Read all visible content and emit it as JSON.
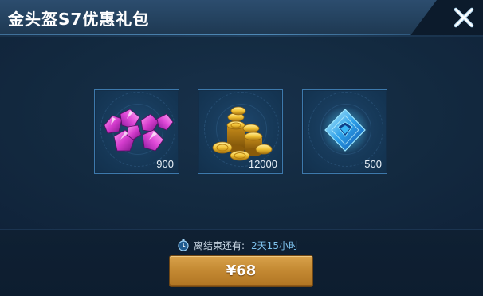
{
  "dialog": {
    "title": "金头盔S7优惠礼包",
    "close_icon": "close-icon"
  },
  "items": [
    {
      "name": "purple-gems",
      "icon": "purple-gem-icon",
      "quantity": "900"
    },
    {
      "name": "gold-coins",
      "icon": "gold-coin-icon",
      "quantity": "12000"
    },
    {
      "name": "blue-crystal",
      "icon": "blue-crystal-icon",
      "quantity": "500"
    }
  ],
  "timer": {
    "icon": "stopwatch-icon",
    "label": "离结束还有:",
    "value": "2天15小时"
  },
  "purchase": {
    "price_label": "¥68"
  },
  "colors": {
    "accent_gold": "#c48a33",
    "timer_value": "#7fc3ee",
    "item_border": "#3d79ac"
  }
}
